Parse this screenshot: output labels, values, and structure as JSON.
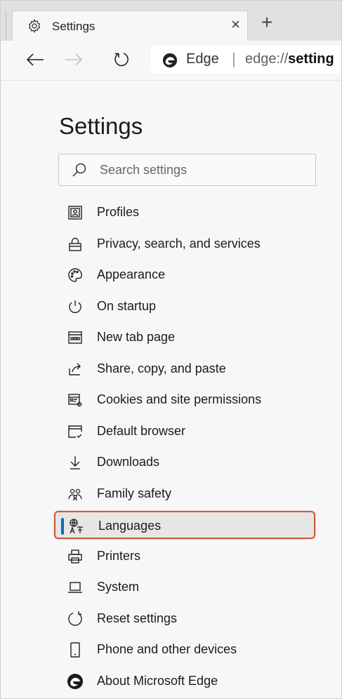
{
  "tab": {
    "title": "Settings",
    "close": "×",
    "new_tab": "+"
  },
  "address": {
    "brand": "Edge",
    "separator": "|",
    "url_prefix": "edge://",
    "url_bold": "setting"
  },
  "page": {
    "title": "Settings"
  },
  "search": {
    "placeholder": "Search settings"
  },
  "nav": {
    "items": [
      {
        "label": "Profiles",
        "icon": "profile-icon"
      },
      {
        "label": "Privacy, search, and services",
        "icon": "lock-icon"
      },
      {
        "label": "Appearance",
        "icon": "palette-icon"
      },
      {
        "label": "On startup",
        "icon": "power-icon"
      },
      {
        "label": "New tab page",
        "icon": "newtab-icon"
      },
      {
        "label": "Share, copy, and paste",
        "icon": "share-icon"
      },
      {
        "label": "Cookies and site permissions",
        "icon": "cookies-icon"
      },
      {
        "label": "Default browser",
        "icon": "browser-icon"
      },
      {
        "label": "Downloads",
        "icon": "download-icon"
      },
      {
        "label": "Family safety",
        "icon": "family-icon"
      },
      {
        "label": "Languages",
        "icon": "language-icon",
        "active": true
      },
      {
        "label": "Printers",
        "icon": "printer-icon"
      },
      {
        "label": "System",
        "icon": "laptop-icon"
      },
      {
        "label": "Reset settings",
        "icon": "reset-icon"
      },
      {
        "label": "Phone and other devices",
        "icon": "phone-icon"
      },
      {
        "label": "About Microsoft Edge",
        "icon": "edge-logo-icon"
      }
    ]
  },
  "colors": {
    "accent": "#0f6cbd",
    "highlight_border": "#cc5a3a"
  }
}
